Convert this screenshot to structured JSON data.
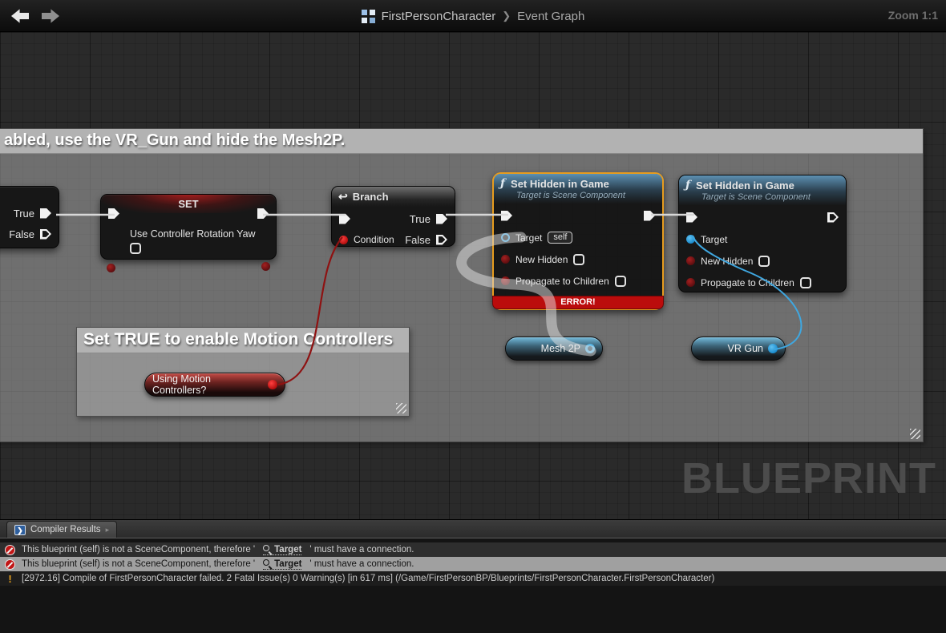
{
  "titlebar": {
    "breadcrumb_root": "FirstPersonCharacter",
    "breadcrumb_sep": "❯",
    "breadcrumb_page": "Event Graph",
    "zoom": "Zoom 1:1"
  },
  "comments": {
    "hide_mesh": {
      "title": "abled, use the VR_Gun and hide the Mesh2P."
    },
    "motion": {
      "title": "Set TRUE to enable Motion Controllers"
    }
  },
  "nodes": {
    "partial_branch": {
      "true_label": "True",
      "false_label": "False"
    },
    "set": {
      "title": "SET",
      "pin_label": "Use Controller Rotation Yaw"
    },
    "branch": {
      "icon": "↩",
      "title": "Branch",
      "condition": "Condition",
      "true_label": "True",
      "false_label": "False"
    },
    "hidden1": {
      "fn_icon": "ƒ",
      "title": "Set Hidden in Game",
      "subtitle": "Target is Scene Component",
      "target": "Target",
      "target_value": "self",
      "new_hidden": "New Hidden",
      "propagate": "Propagate to Children",
      "error": "ERROR!"
    },
    "hidden2": {
      "fn_icon": "ƒ",
      "title": "Set Hidden in Game",
      "subtitle": "Target is Scene Component",
      "target": "Target",
      "new_hidden": "New Hidden",
      "propagate": "Propagate to Children"
    },
    "mesh2p": {
      "label": "Mesh 2P"
    },
    "vrgun": {
      "label": "VR Gun"
    },
    "motion_var": {
      "label": "Using Motion Controllers?"
    }
  },
  "watermark": "BLUEPRINT",
  "compiler": {
    "tab": "Compiler Results",
    "tab_icon": "❯",
    "rows": [
      {
        "pre": "This blueprint (self) is not a SceneComponent, therefore '",
        "link": "Target",
        "post": "' must have a connection."
      },
      {
        "pre": "This blueprint (self) is not a SceneComponent, therefore '",
        "link": "Target",
        "post": "' must have a connection."
      },
      {
        "text": "[2972.16] Compile of FirstPersonCharacter failed. 2 Fatal Issue(s) 0 Warning(s) [in 617 ms] (/Game/FirstPersonBP/Blueprints/FirstPersonCharacter.FirstPersonCharacter)"
      }
    ],
    "warn_glyph": "!"
  },
  "colors": {
    "error_outline": "#e79c1e",
    "error_bar": "#bb0c0c",
    "object_pin": "#2aa3e8",
    "bool_pin": "#8c1616",
    "wire_exec": "#d8d8d8",
    "wire_red": "#8e1212",
    "wire_blue": "#3fa7e0"
  }
}
